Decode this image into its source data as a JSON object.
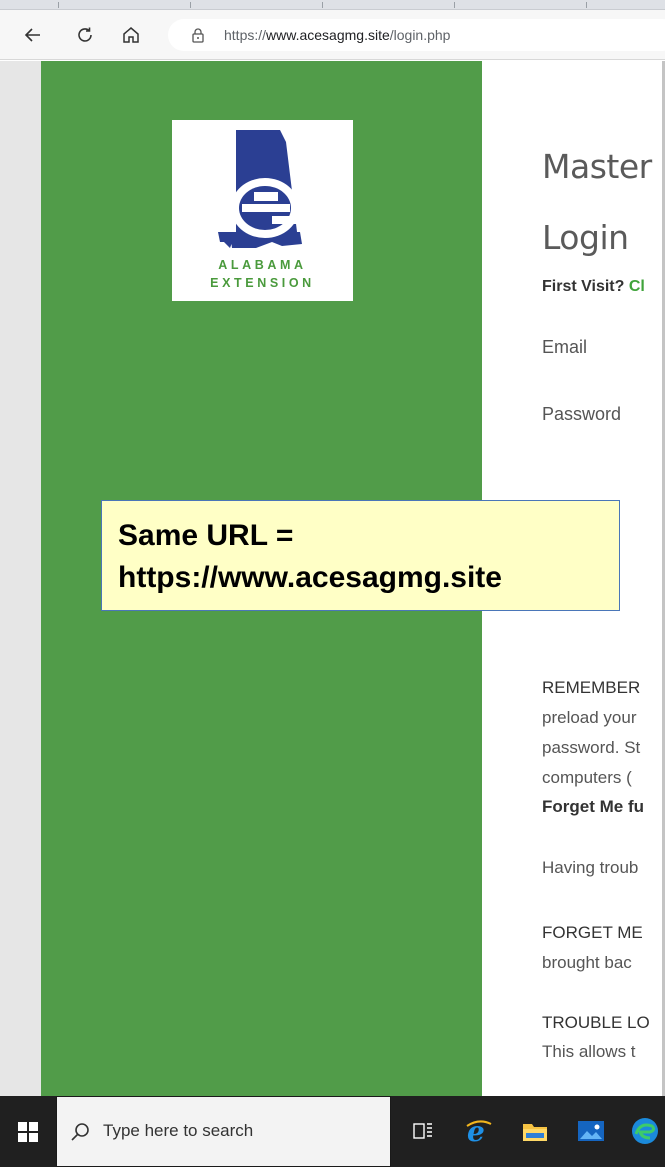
{
  "browser": {
    "url": {
      "scheme": "https://",
      "host": "www.acesagmg.site",
      "path": "/login.php"
    },
    "icons": {
      "back": "back-arrow-icon",
      "refresh": "refresh-icon",
      "home": "home-icon",
      "lock": "lock-icon"
    }
  },
  "logo": {
    "letter": "e",
    "line1": "ALABAMA",
    "line2": "EXTENSION",
    "colors": {
      "navy": "#2b3f93",
      "green": "#4a9a3c"
    }
  },
  "page": {
    "title_line1": "Master",
    "title_line2": "Login",
    "first_visit_label": "First Visit?",
    "first_visit_link": "Cl",
    "email_label": "Email",
    "password_label": "Password",
    "para1": [
      "REMEMBER",
      "preload your",
      "password. St",
      "computers (",
      "Forget Me fu"
    ],
    "para2": "Having troub",
    "para3": [
      "FORGET ME",
      "brought bac"
    ],
    "para4": [
      "TROUBLE LO",
      "This allows t"
    ]
  },
  "callout": {
    "line1": "Same URL =",
    "line2": "https://www.acesagmg.site"
  },
  "taskbar": {
    "search_placeholder": "Type here to search",
    "icons": [
      "windows-start-icon",
      "search-icon",
      "task-view-icon",
      "internet-explorer-icon",
      "file-explorer-icon",
      "photos-icon",
      "edge-icon"
    ]
  },
  "colors": {
    "green_panel": "#519c49",
    "callout_bg": "#ffffc6",
    "callout_border": "#4a76b8",
    "link_green": "#3fa33a"
  }
}
